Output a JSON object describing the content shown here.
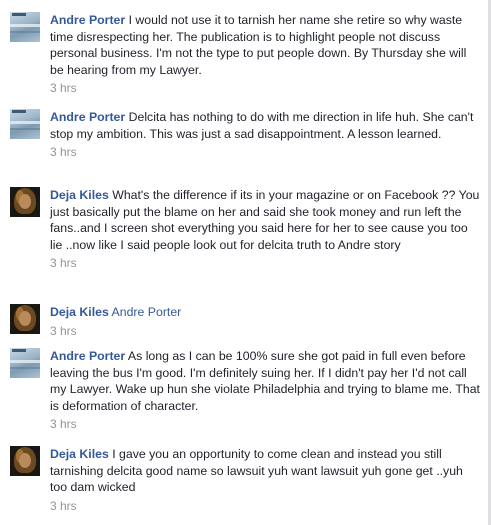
{
  "comments": [
    {
      "author": "Andre Porter",
      "avatar": "seascape-avatar",
      "text": "I would not use it to tarnish her name she retire so why waste time disrespecting her. The publication is to highlight people not discuss personal business. I'm not the type to put people down. By Thursday she will be hearing from my Lawyer.",
      "time": "3 hrs"
    },
    {
      "author": "Andre Porter",
      "avatar": "seascape-avatar",
      "text": "Delcita has nothing to do with me direction in life huh. She can't stop my ambition. This was just a sad disappointment. A lesson learned.",
      "time": "3 hrs"
    },
    {
      "author": "Deja Kiles",
      "avatar": "portrait-avatar",
      "text": "What's the difference if its in your magazine or on Facebook ?? You just basically put the blame on her and said she took money and run left the fans..and I screen shot everything you said here for her to see cause you too lie ..now like I said people look out for delcita truth to Andre story",
      "time": "3 hrs"
    },
    {
      "author": "Deja Kiles",
      "avatar": "portrait-avatar",
      "mention": "Andre Porter",
      "time": "3 hrs"
    },
    {
      "author": "Andre Porter",
      "avatar": "seascape-avatar",
      "text": "As long as I can be 100% sure she got paid in full even before leaving the bus I'm good. I'm definitely suing her. If I didn't pay her I'd not call my Lawyer. Wake up hun she violate Philadelphia and trying to blame me. That is deformation of character.",
      "time": "3 hrs"
    },
    {
      "author": "Deja Kiles",
      "avatar": "portrait-avatar",
      "text": "I gave you an opportunity to come clean and instead you still tarnishing delcita good name so lawsuit yuh want lawsuit yuh gone get ..yuh too dam wicked",
      "time": "3 hrs"
    }
  ]
}
